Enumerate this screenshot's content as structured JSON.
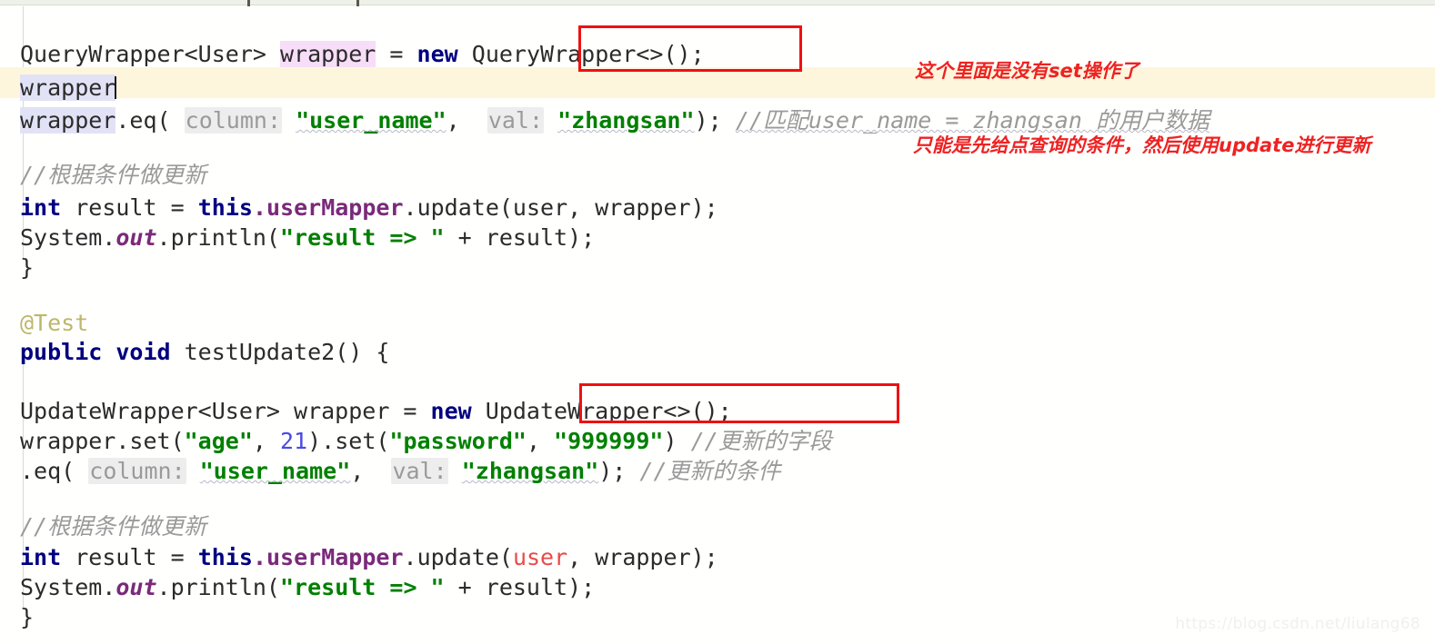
{
  "editor": {
    "background": "#fffffe",
    "caret_line_color": "#fdf6dd",
    "annotation_color": "#ee2222",
    "box_color": "#ee1111",
    "watermark": "https://blog.csdn.net/liulang68"
  },
  "code_block_1": {
    "line_1": {
      "type_decl": "QueryWrapper<User>",
      "var_declared": "wrapper",
      "equals": "=",
      "keyword_new": "new",
      "boxed_ctor": "QueryWrapper<>",
      "tail": "();"
    },
    "line_2": {
      "text": "wrapper",
      "has_caret": true
    },
    "line_3": {
      "receiver": "wrapper",
      "method": ".eq(",
      "hint_1": "column:",
      "arg_1": "\"user_name\"",
      "sep": ",",
      "hint_2": "val:",
      "arg_2": "\"zhangsan\"",
      "tail": ");",
      "comment": "//匹配user_name = zhangsan 的用户数据"
    },
    "line_4": {
      "comment": "//根据条件做更新"
    },
    "line_5": {
      "keyword": "int",
      "var": "result",
      "equals": "=",
      "this_kw": "this",
      "field": ".userMapper",
      "call": ".update(user, wrapper);"
    },
    "line_6": {
      "pre": "System.",
      "static_field": "out",
      "call": ".println(",
      "str": "\"result => \"",
      "tail": " + result);"
    },
    "line_7": {
      "brace": "}"
    }
  },
  "code_block_2": {
    "annotation": "@Test",
    "signature": {
      "modifiers": "public void",
      "method": " testUpdate2() {"
    },
    "line_1": {
      "type_decl": "UpdateWrapper<User> wrapper = ",
      "keyword_new": "new",
      "boxed_ctor": " UpdateWrapper<>();"
    },
    "line_2": {
      "receiver": "wrapper.set(",
      "str_1": "\"age\"",
      "sep_1": ", ",
      "num": "21",
      "mid": ").set(",
      "str_2": "\"password\"",
      "sep_2": ", ",
      "str_3": "\"999999\"",
      "tail": ")",
      "comment": "//更新的字段"
    },
    "line_3": {
      "method": ".eq(",
      "hint_1": "column:",
      "arg_1": "\"user_name\"",
      "sep": ",",
      "hint_2": "val:",
      "arg_2": "\"zhangsan\"",
      "tail": ");",
      "comment": "//更新的条件"
    },
    "line_4": {
      "comment": "//根据条件做更新"
    },
    "line_5": {
      "keyword": "int",
      "var": "result",
      "equals": "=",
      "this_kw": "this",
      "field": ".userMapper",
      "call_open": ".update(",
      "error_arg": "user",
      "call_rest": ", wrapper);"
    },
    "line_6": {
      "pre": "System.",
      "static_field": "out",
      "call": ".println(",
      "str": "\"result => \"",
      "tail": " + result);"
    },
    "line_7": {
      "brace": "}"
    }
  },
  "annotations": {
    "note_1": "这个里面是没有set操作了",
    "note_2": "只能是先给点查询的条件，然后使用update进行更新"
  }
}
